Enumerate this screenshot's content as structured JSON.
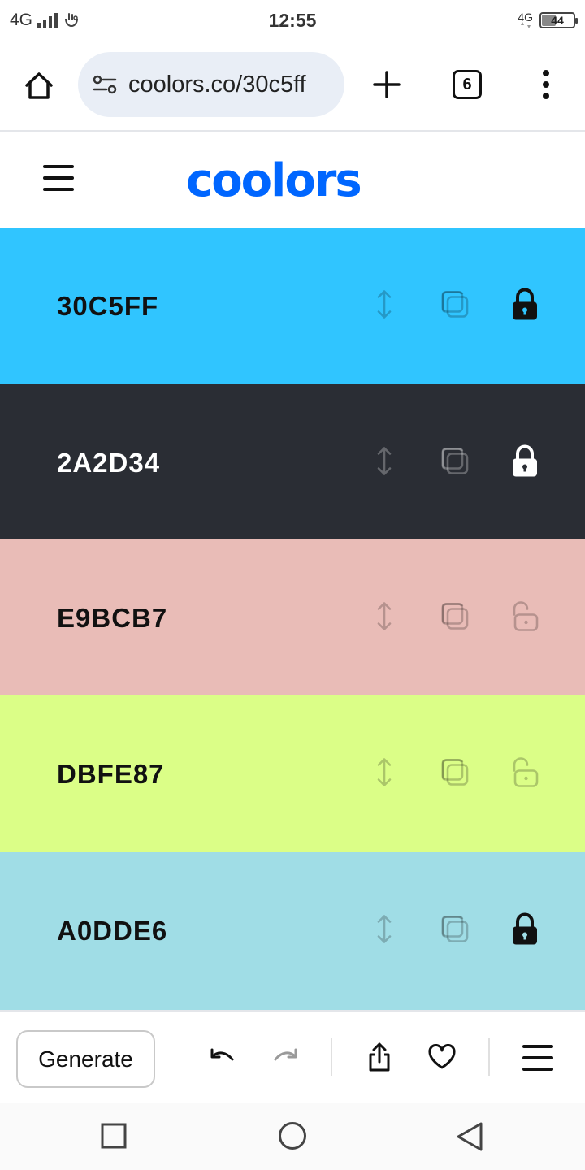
{
  "status_bar": {
    "network_left": "4G",
    "time": "12:55",
    "network_right": "4G",
    "battery": "44"
  },
  "browser": {
    "url": "coolors.co/30c5ff",
    "tab_count": "6"
  },
  "app": {
    "logo": "coolors"
  },
  "palette": [
    {
      "hex": "30C5FF",
      "bg": "#30C5FF",
      "text": "#111111",
      "locked": true
    },
    {
      "hex": "2A2D34",
      "bg": "#2A2D34",
      "text": "#FFFFFF",
      "locked": true
    },
    {
      "hex": "E9BCB7",
      "bg": "#E9BCB7",
      "text": "#111111",
      "locked": false
    },
    {
      "hex": "DBFE87",
      "bg": "#DBFE87",
      "text": "#111111",
      "locked": false
    },
    {
      "hex": "A0DDE6",
      "bg": "#A0DDE6",
      "text": "#111111",
      "locked": true
    }
  ],
  "toolbar": {
    "generate_label": "Generate"
  },
  "colors": {
    "brand": "#0066FF"
  }
}
